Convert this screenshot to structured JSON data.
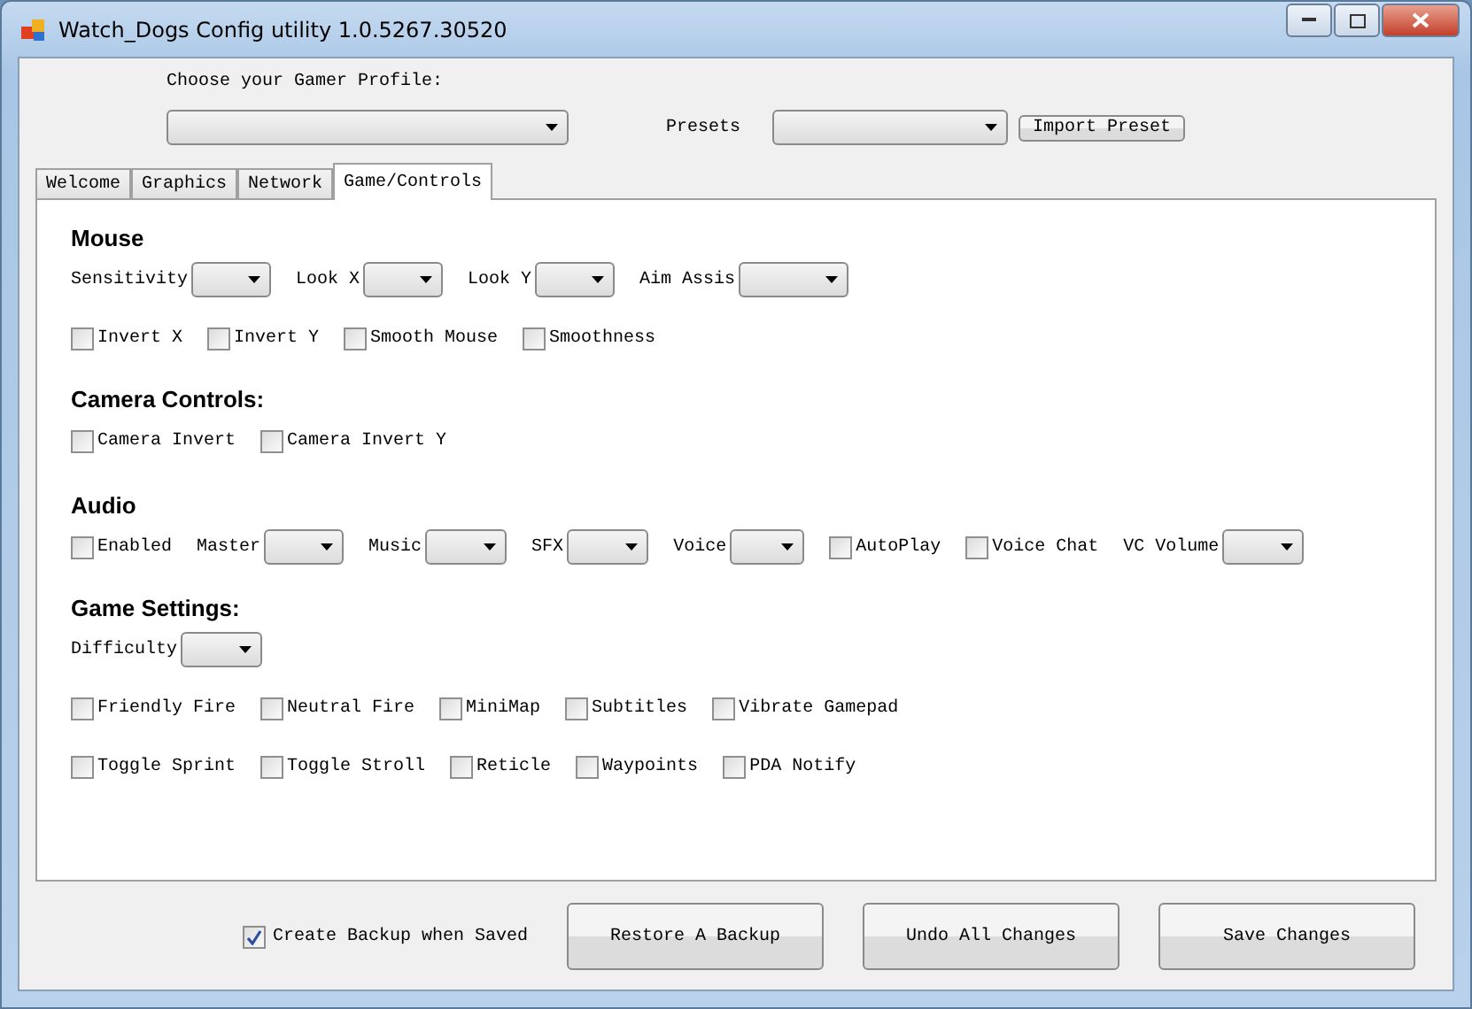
{
  "window": {
    "title": "Watch_Dogs Config utility 1.0.5267.30520"
  },
  "profile": {
    "label": "Choose your Gamer Profile:",
    "presets_label": "Presets",
    "import_button": "Import Preset"
  },
  "tabs": [
    {
      "label": "Welcome",
      "selected": false
    },
    {
      "label": "Graphics",
      "selected": false
    },
    {
      "label": "Network",
      "selected": false
    },
    {
      "label": "Game/Controls",
      "selected": true
    }
  ],
  "sections": [
    {
      "title": "Mouse",
      "rows": [
        [
          {
            "kind": "combo",
            "label": "Sensitivity"
          },
          {
            "kind": "combo",
            "label": "Look X"
          },
          {
            "kind": "combo",
            "label": "Look Y"
          },
          {
            "kind": "combo",
            "label": "Aim Assis"
          }
        ],
        [
          {
            "kind": "checkbox",
            "label": "Invert X",
            "checked": false
          },
          {
            "kind": "checkbox",
            "label": "Invert Y",
            "checked": false
          },
          {
            "kind": "checkbox",
            "label": "Smooth Mouse",
            "checked": false
          },
          {
            "kind": "checkbox",
            "label": "Smoothness",
            "checked": false
          }
        ]
      ]
    },
    {
      "title": "Camera Controls:",
      "rows": [
        [
          {
            "kind": "checkbox",
            "label": "Camera Invert",
            "checked": false
          },
          {
            "kind": "checkbox",
            "label": "Camera Invert Y",
            "checked": false
          }
        ]
      ]
    },
    {
      "title": "Audio",
      "rows": [
        [
          {
            "kind": "checkbox",
            "label": "Enabled",
            "checked": false
          },
          {
            "kind": "combo",
            "label": "Master"
          },
          {
            "kind": "combo",
            "label": "Music"
          },
          {
            "kind": "combo",
            "label": "SFX"
          },
          {
            "kind": "combo",
            "label": "Voice"
          },
          {
            "kind": "checkbox",
            "label": "AutoPlay",
            "checked": false
          },
          {
            "kind": "checkbox",
            "label": "Voice Chat",
            "checked": false
          },
          {
            "kind": "combo",
            "label": "VC Volume"
          }
        ]
      ]
    },
    {
      "title": "Game Settings:",
      "rows": [
        [
          {
            "kind": "combo",
            "label": "Difficulty"
          }
        ],
        [
          {
            "kind": "checkbox",
            "label": "Friendly Fire",
            "checked": false
          },
          {
            "kind": "checkbox",
            "label": "Neutral Fire",
            "checked": false
          },
          {
            "kind": "checkbox",
            "label": "MiniMap",
            "checked": false
          },
          {
            "kind": "checkbox",
            "label": "Subtitles",
            "checked": false
          },
          {
            "kind": "checkbox",
            "label": "Vibrate Gamepad",
            "checked": false
          }
        ],
        [
          {
            "kind": "checkbox",
            "label": "Toggle Sprint",
            "checked": false
          },
          {
            "kind": "checkbox",
            "label": "Toggle Stroll",
            "checked": false
          },
          {
            "kind": "checkbox",
            "label": "Reticle",
            "checked": false
          },
          {
            "kind": "checkbox",
            "label": "Waypoints",
            "checked": false
          },
          {
            "kind": "checkbox",
            "label": "PDA Notify",
            "checked": false
          }
        ]
      ]
    }
  ],
  "footer": {
    "backup": {
      "label": "Create Backup when Saved",
      "checked": true
    },
    "buttons": [
      "Restore A Backup",
      "Undo All Changes",
      "Save Changes"
    ]
  }
}
